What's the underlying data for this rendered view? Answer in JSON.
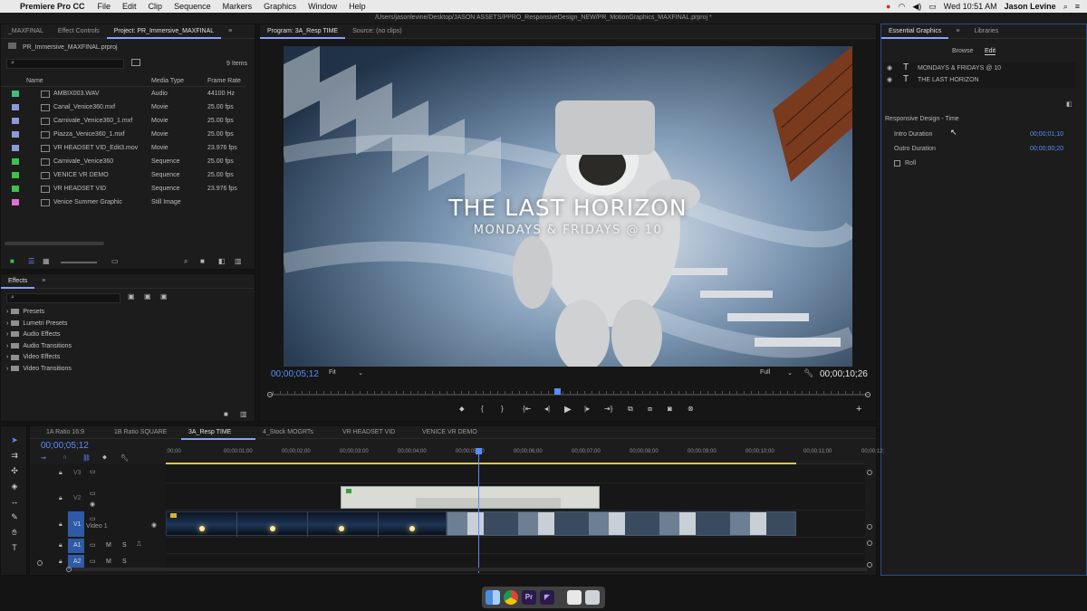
{
  "menubar": {
    "app": "Premiere Pro CC",
    "items": [
      "File",
      "Edit",
      "Clip",
      "Sequence",
      "Markers",
      "Graphics",
      "Window",
      "Help"
    ],
    "clock": "Wed 10:51 AM",
    "user": "Jason Levine"
  },
  "path": "/Users/jasonlevine/Desktop/JASON ASSETS/PPRO_ResponsiveDesign_NEW/PR_MotionGraphics_MAXFINAL.prproj *",
  "project": {
    "tabs": [
      "_MAXFINAL",
      "Effect Controls",
      "Project: PR_Immersive_MAXFINAL"
    ],
    "file": "PR_Immersive_MAXFINAL.prproj",
    "count": "9 Items",
    "columns": [
      "Name",
      "Media Type",
      "Frame Rate"
    ],
    "items": [
      {
        "name": "AMBIX003.WAV",
        "type": "Audio",
        "rate": "44100 Hz",
        "color": "#3fbf78"
      },
      {
        "name": "Canal_Venice360.mxf",
        "type": "Movie",
        "rate": "25.00 fps",
        "color": "#8e99d8"
      },
      {
        "name": "Carnivale_Venice360_1.mxf",
        "type": "Movie",
        "rate": "25.00 fps",
        "color": "#8e99d8"
      },
      {
        "name": "Piazza_Venice360_1.mxf",
        "type": "Movie",
        "rate": "25.00 fps",
        "color": "#8e99d8"
      },
      {
        "name": "VR HEADSET VID_Edit3.mov",
        "type": "Movie",
        "rate": "23.976 fps",
        "color": "#8e99d8"
      },
      {
        "name": "Carnivale_Venice360",
        "type": "Sequence",
        "rate": "25.00 fps",
        "color": "#3fbf50"
      },
      {
        "name": "VENICE VR DEMO",
        "type": "Sequence",
        "rate": "25.00 fps",
        "color": "#3fbf50"
      },
      {
        "name": "VR HEADSET VID",
        "type": "Sequence",
        "rate": "23.976 fps",
        "color": "#3fbf50"
      },
      {
        "name": "Venice Summer Graphic",
        "type": "Still Image",
        "rate": "",
        "color": "#e070d0"
      }
    ]
  },
  "effects": {
    "title": "Effects",
    "folders": [
      "Presets",
      "Lumetri Presets",
      "Audio Effects",
      "Audio Transitions",
      "Video Effects",
      "Video Transitions"
    ]
  },
  "program": {
    "tabs": [
      "Program: 3A_Resp TIME",
      "Source: (no clips)"
    ],
    "title_main": "THE LAST HORIZON",
    "title_sub": "MONDAYS & FRIDAYS @ 10",
    "timecode": "00;00;05;12",
    "fit": "Fit",
    "quality": "Full",
    "duration": "00;00;10;26",
    "playhead_pct": 48
  },
  "essential": {
    "tabs": [
      "Essential Graphics",
      "Libraries"
    ],
    "subtabs": [
      "Browse",
      "Edit"
    ],
    "layers": [
      "MONDAYS & FRIDAYS @ 10",
      "THE LAST HORIZON"
    ],
    "section": "Responsive Design - Time",
    "intro_label": "Intro Duration",
    "intro_value": "00;00;01;10",
    "outro_label": "Outro Duration",
    "outro_value": "00;00;00;20",
    "roll_label": "Roll"
  },
  "timeline": {
    "tabs": [
      "1A Ratio 16:9",
      "1B Ratio SQUARE",
      "3A_Resp TIME",
      "4_Stock MOGRTs",
      "VR HEADSET VID",
      "VENICE VR DEMO"
    ],
    "timecode": "00;00;05;12",
    "ruler": [
      ":00;00",
      "00;00;01;00",
      "00;00;02;00",
      "00;00;03;00",
      "00;00;04;00",
      "00;00;05;00",
      "00;00;06;00",
      "00;00;07;00",
      "00;00;08;00",
      "00;00;09;00",
      "00;00;10;00",
      "00;00;11;00",
      "00;00;12;"
    ],
    "tracks": {
      "v3": "V3",
      "v2": "V2",
      "v1": "V1",
      "v1_name": "Video 1",
      "a1": "A1",
      "a2": "A2",
      "m": "M",
      "s": "S"
    }
  },
  "colors": {
    "accent": "#5a8cff",
    "panel": "#1c1c1c"
  }
}
